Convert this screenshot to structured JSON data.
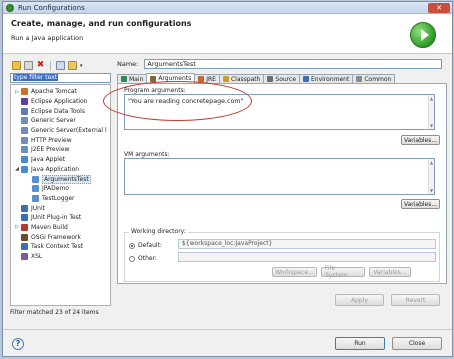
{
  "window": {
    "title": "Run Configurations",
    "close_glyph": "✕"
  },
  "header": {
    "title": "Create, manage, and run configurations",
    "description": "Run a Java application",
    "logo_icon": "run-icon"
  },
  "left": {
    "toolbar_icons": [
      "new-config-icon",
      "duplicate-icon",
      "delete-icon",
      "collapse-all-icon",
      "filter-icon"
    ],
    "filter": {
      "value": "type filter text"
    },
    "tree": [
      {
        "label": "Apache Tomcat",
        "twisty": "▷",
        "depth": 0,
        "icon_color": "#c8742a"
      },
      {
        "label": "Eclipse Application",
        "twisty": "",
        "depth": 0,
        "icon_color": "#5b3fa0"
      },
      {
        "label": "Eclipse Data Tools",
        "twisty": "",
        "depth": 0,
        "icon_color": "#5a7fb5"
      },
      {
        "label": "Generic Server",
        "twisty": "",
        "depth": 0,
        "icon_color": "#6b8fb8"
      },
      {
        "label": "Generic Server(External l",
        "twisty": "",
        "depth": 0,
        "icon_color": "#6b8fb8"
      },
      {
        "label": "HTTP Preview",
        "twisty": "",
        "depth": 0,
        "icon_color": "#6b8fb8"
      },
      {
        "label": "J2EE Preview",
        "twisty": "",
        "depth": 0,
        "icon_color": "#6b8fb8"
      },
      {
        "label": "Java Applet",
        "twisty": "",
        "depth": 0,
        "icon_color": "#4d8ac9"
      },
      {
        "label": "Java Application",
        "twisty": "◢",
        "depth": 0,
        "icon_color": "#4d8ac9"
      },
      {
        "label": "ArgumentsTest",
        "twisty": "",
        "depth": 1,
        "icon_color": "#5c8fd0",
        "selected": true
      },
      {
        "label": "JPADemo",
        "twisty": "",
        "depth": 1,
        "icon_color": "#5c8fd0"
      },
      {
        "label": "TestLogger",
        "twisty": "",
        "depth": 1,
        "icon_color": "#5c8fd0"
      },
      {
        "label": "JUnit",
        "twisty": "",
        "depth": 0,
        "icon_color": "#3a6fb0"
      },
      {
        "label": "JUnit Plug-in Test",
        "twisty": "",
        "depth": 0,
        "icon_color": "#3a6fb0"
      },
      {
        "label": "Maven Build",
        "twisty": "▷",
        "depth": 0,
        "icon_color": "#b23a2e"
      },
      {
        "label": "OSGi Framework",
        "twisty": "",
        "depth": 0,
        "icon_color": "#6b4a2e"
      },
      {
        "label": "Task Context Test",
        "twisty": "",
        "depth": 0,
        "icon_color": "#3a6fb0"
      },
      {
        "label": "XSL",
        "twisty": "",
        "depth": 0,
        "icon_color": "#7a5a9a"
      }
    ],
    "filtered_status": "Filter matched 23 of 24 items"
  },
  "right": {
    "name_label": "Name:",
    "name_value": "ArgumentsTest",
    "tabs": [
      {
        "label": "Main",
        "icon": "main-tab-icon",
        "color": "#2e8b57"
      },
      {
        "label": "Arguments",
        "icon": "arguments-tab-icon",
        "color": "#7a6a3a",
        "active": true
      },
      {
        "label": "JRE",
        "icon": "jre-tab-icon",
        "color": "#c46a2a"
      },
      {
        "label": "Classpath",
        "icon": "classpath-tab-icon",
        "color": "#c9a12a"
      },
      {
        "label": "Source",
        "icon": "source-tab-icon",
        "color": "#6c6c6c"
      },
      {
        "label": "Environment",
        "icon": "environment-tab-icon",
        "color": "#3a6fb0"
      },
      {
        "label": "Common",
        "icon": "common-tab-icon",
        "color": "#8a8a8a"
      }
    ],
    "program_args_label": "Program arguments:",
    "program_args_value": "\"You are reading concretepage.com\"",
    "vm_args_label": "VM arguments:",
    "vm_args_value": "",
    "variables_label": "Variables...",
    "working_dir_label": "Working directory:",
    "default_label": "Default:",
    "default_value": "${workspace_loc:JavaProject}",
    "other_label": "Other:",
    "other_value": "",
    "workspace_btn": "Workspace...",
    "file_system_btn": "File System...",
    "variables_btn2": "Variables...",
    "apply_label": "Apply",
    "revert_label": "Revert"
  },
  "footer": {
    "help_glyph": "?",
    "run_label": "Run",
    "close_label": "Close"
  }
}
